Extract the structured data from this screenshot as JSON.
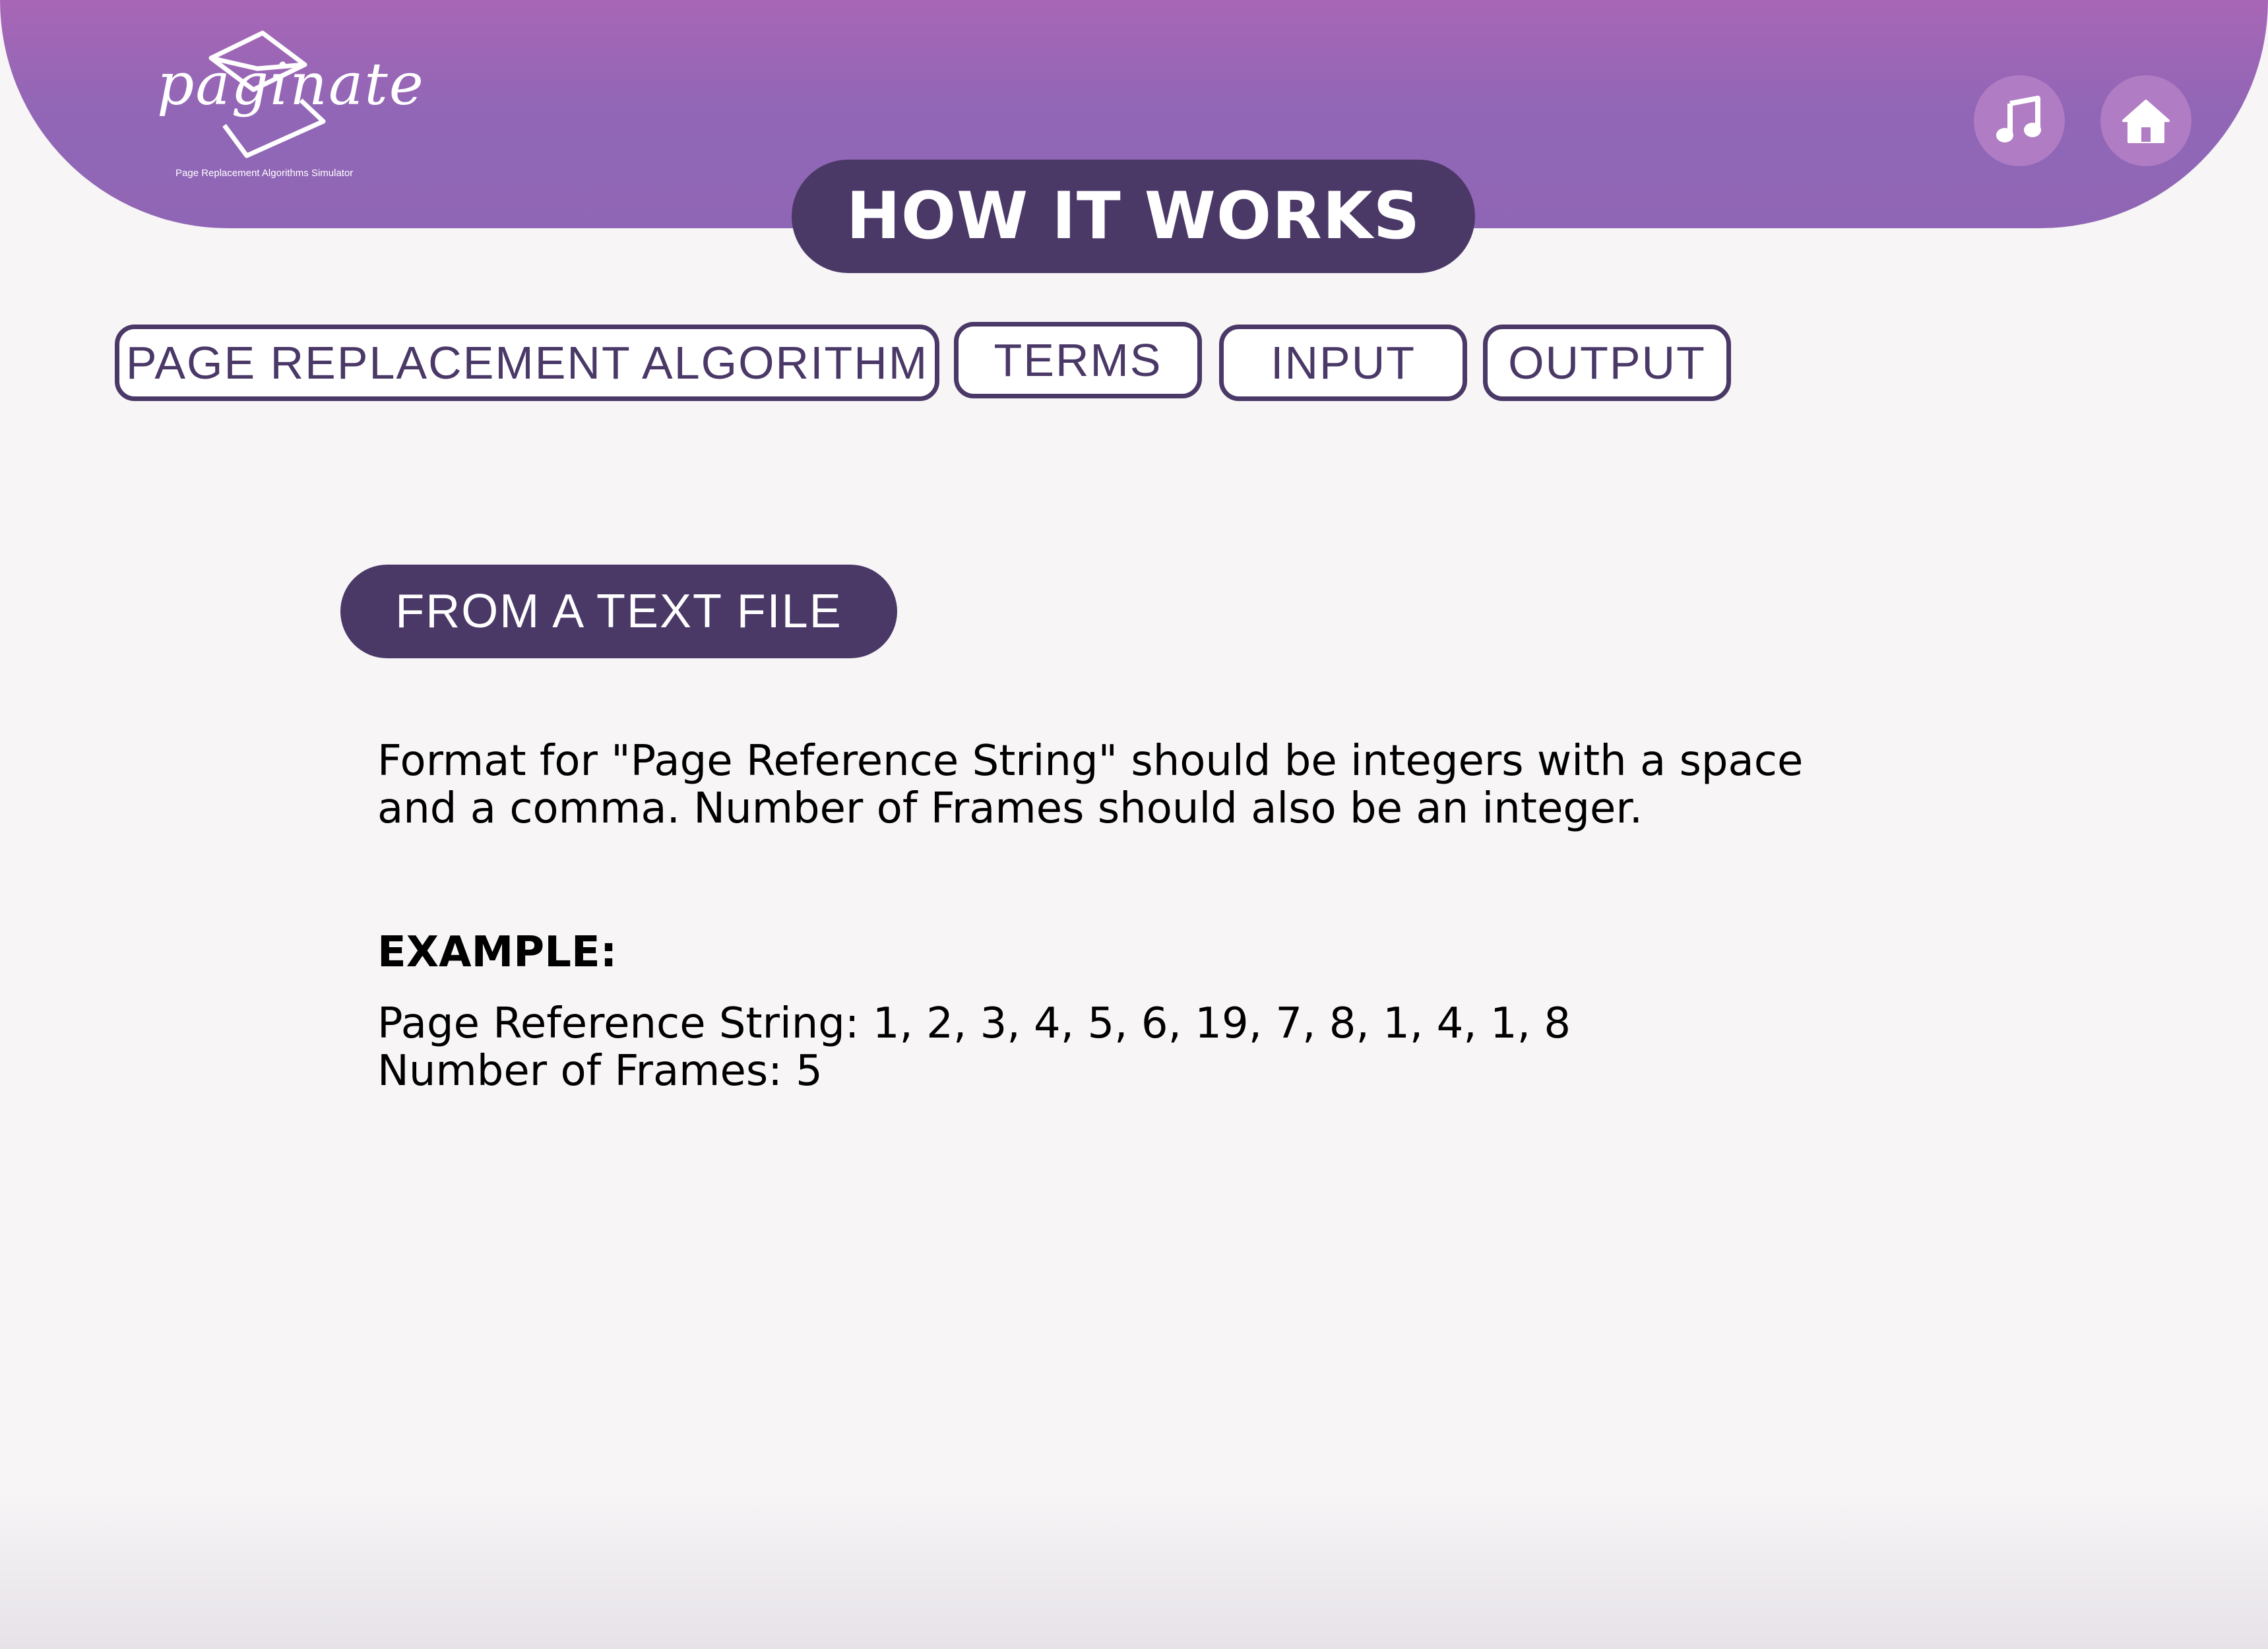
{
  "header": {
    "logo": {
      "wordmark": "paginate",
      "tagline": "Page Replacement Algorithms Simulator"
    },
    "title": "HOW IT WORKS",
    "buttons": [
      {
        "icon": "music-note-icon"
      },
      {
        "icon": "home-icon"
      }
    ]
  },
  "tabs": [
    {
      "label": "PAGE REPLACEMENT ALGORITHM"
    },
    {
      "label": "TERMS"
    },
    {
      "label": "INPUT"
    },
    {
      "label": "OUTPUT"
    }
  ],
  "section": {
    "title": "FROM A TEXT FILE",
    "format_lines": [
      "Format for \"Page Reference String\" should be integers with a space",
      "and a comma. Number of Frames should also be an integer."
    ],
    "example": {
      "heading": "EXAMPLE:",
      "page_reference_string": "Page Reference String: 1, 2, 3, 4, 5, 6, 19, 7, 8, 1, 4, 1, 8",
      "number_of_frames": "Number of Frames: 5"
    }
  },
  "colors": {
    "header_gradient_top": "#a866b6",
    "header_gradient_bottom": "#8f66b5",
    "accent_dark": "#4a3867",
    "icon_button": "#b07cc4",
    "background": "#f7f5f6"
  }
}
